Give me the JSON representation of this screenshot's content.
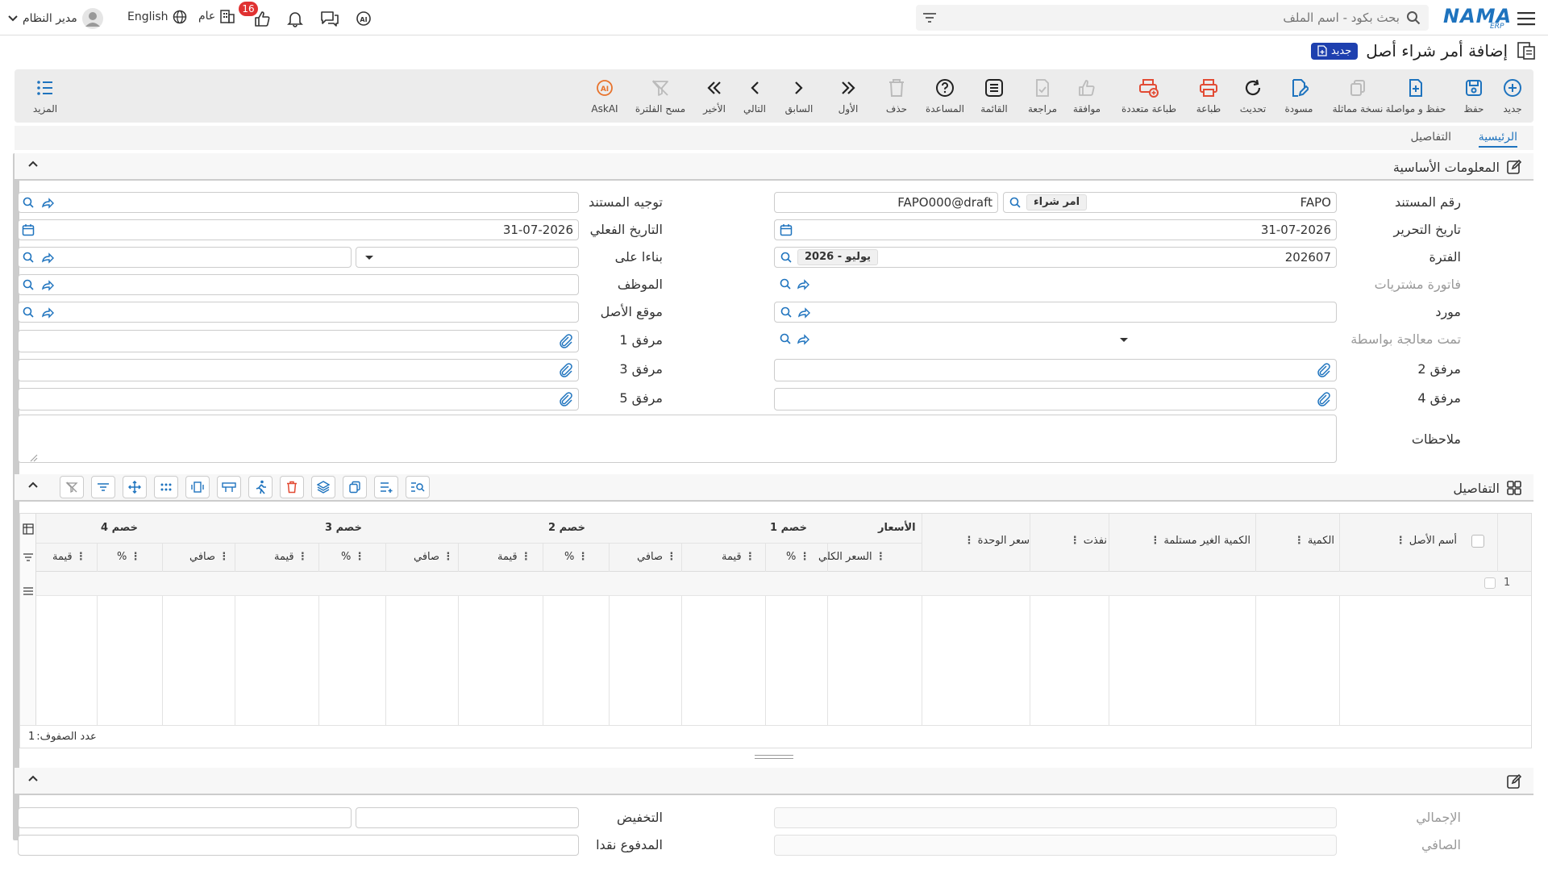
{
  "topbar": {
    "user_name": "مدير النظام",
    "language": "English",
    "company": "عام",
    "notifications_badge": "16",
    "search_placeholder": "بحث بكود - اسم الملف",
    "logo_text": "NAMA",
    "logo_sub": "ERP"
  },
  "page": {
    "title": "إضافة أمر شراء أصل",
    "new_badge": "جديد"
  },
  "toolbar": {
    "new": "جديد",
    "save": "حفظ",
    "save_continue": "حفظ و مواصلة",
    "duplicate": "نسخة مماثلة",
    "draft": "مسودة",
    "refresh": "تحديث",
    "print": "طباعة",
    "multi_print": "طباعة متعددة",
    "approve": "موافقة",
    "review": "مراجعة",
    "list": "القائمة",
    "help": "المساعدة",
    "delete": "حذف",
    "first": "الأول",
    "previous": "السابق",
    "next": "التالي",
    "last": "الأخير",
    "clear_filter": "مسح الفلترة",
    "askai": "AskAI",
    "more": "المزيد"
  },
  "tabs": {
    "main": "الرئيسية",
    "details": "التفاصيل"
  },
  "basic_info": {
    "title": "المعلومات الأساسية",
    "doc_number_label": "رقم المستند",
    "doc_number_value": "FAPO",
    "doc_type_tag": "امر شراء",
    "doc_code_value": "FAPO000@draft",
    "doc_routing_label": "توجيه المستند",
    "date_label": "تاريخ التحرير",
    "date_value": "31-07-2026",
    "actual_date_label": "التاريخ الفعلي",
    "actual_date_value": "31-07-2026",
    "period_label": "الفترة",
    "period_value": "202607",
    "period_tag": "2026 - يوليو",
    "based_on_label": "بناءا على",
    "purchase_invoice_label": "فاتورة مشتريات",
    "employee_label": "الموظف",
    "supplier_label": "مورد",
    "asset_location_label": "موقع الأصل",
    "processed_by_label": "تمت معالجة بواسطة",
    "attachment1_label": "مرفق 1",
    "attachment2_label": "مرفق 2",
    "attachment3_label": "مرفق 3",
    "attachment4_label": "مرفق 4",
    "attachment5_label": "مرفق 5",
    "notes_label": "ملاحظات"
  },
  "details": {
    "title": "التفاصيل",
    "columns": {
      "asset_name": "أسم الأصل",
      "quantity": "الكمية",
      "unreceived_qty": "الكمية الغير مستلمة",
      "executed": "نفذت",
      "unit_price": "سعر الوحدة",
      "prices_group": "الأسعار",
      "total_price": "السعر الكلي",
      "discount1": "خصم 1",
      "discount2": "خصم 2",
      "discount3": "خصم 3",
      "discount4": "خصم 4",
      "percent": "%",
      "value": "قيمة",
      "net": "صافي"
    },
    "row_number": "1",
    "row_count_label": "عدد الصفوف:",
    "row_count": "1"
  },
  "totals": {
    "total_label": "الإجمالي",
    "discount_label": "التخفيض",
    "net_label": "الصافي",
    "paid_cash_label": "المدفوع نقدا"
  }
}
